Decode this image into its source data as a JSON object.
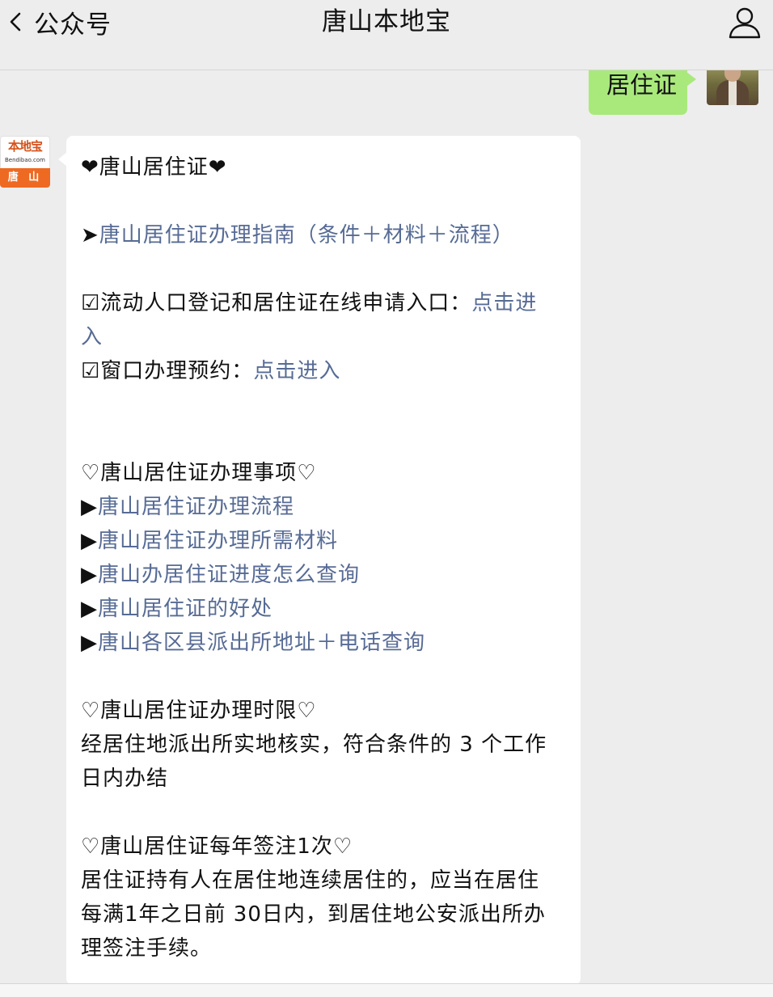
{
  "header": {
    "back_label": "公众号",
    "title": "唐山本地宝"
  },
  "sent_message": {
    "text": "居住证"
  },
  "oa_avatar": {
    "logo_text": "本地宝",
    "logo_sub": "Bendibao.com",
    "logo_city": "唐 山",
    "brand_color": "#ee6a22"
  },
  "reply": {
    "heading": "❤唐山居住证❤",
    "guide_prefix": "➤",
    "guide_link": "唐山居住证办理指南（条件＋材料＋流程）",
    "online_prefix": "☑流动人口登记和居住证在线申请入口：",
    "online_link_part1": "点击进",
    "online_link_part2": "入",
    "window_prefix": "☑窗口办理预约：",
    "window_link": "点击进入",
    "matters_heading": "♡唐山居住证办理事项♡",
    "matters_bullet": "▶",
    "matters": [
      "唐山居住证办理流程",
      "唐山居住证办理所需材料",
      "唐山办居住证进度怎么查询",
      "唐山居住证的好处",
      "唐山各区县派出所地址＋电话查询"
    ],
    "time_heading": "♡唐山居住证办理时限♡",
    "time_line1": "经居住地派出所实地核实，符合条件的 3 个工作",
    "time_line2": "日内办结",
    "annual_heading": "♡唐山居住证每年签注1次♡",
    "annual_line1": "居住证持有人在居住地连续居住的，应当在居住",
    "annual_line2": "每满1年之日前 30日内，到居住地公安派出所办",
    "annual_line3": "理签注手续。"
  },
  "colors": {
    "background": "#ededed",
    "sent_bubble": "#a9e97c",
    "link": "#576b95"
  }
}
